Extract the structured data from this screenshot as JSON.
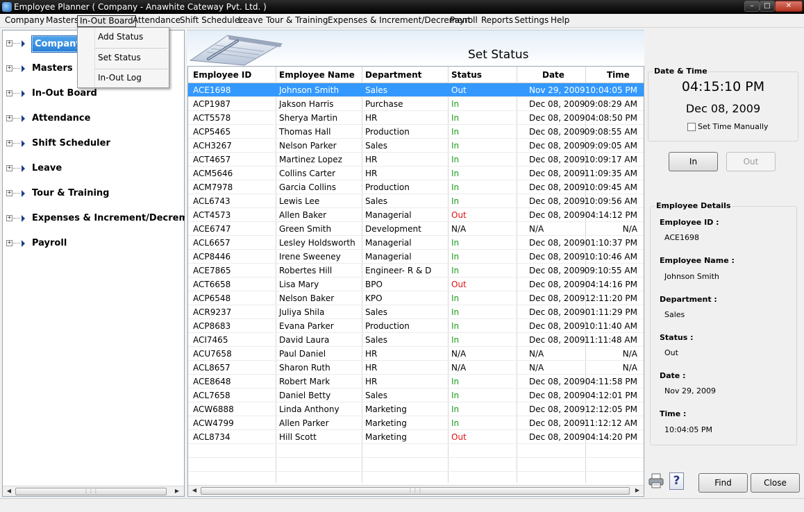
{
  "window": {
    "title": "Employee Planner ( Company - Anawhite Cateway Pvt. Ltd. )"
  },
  "menubar": {
    "items": [
      "Company",
      "Masters",
      "In-Out Board",
      "Attendance",
      "Shift Scheduler",
      "Leave",
      "Tour & Training",
      "Expenses & Increment/Decrement",
      "Payroll",
      "Reports",
      "Settings",
      "Help"
    ],
    "open_item": "In-Out Board"
  },
  "dropdown": {
    "items": [
      "Add Status",
      "Set Status",
      "In-Out Log"
    ]
  },
  "tree": {
    "items": [
      "Company",
      "Masters",
      "In-Out Board",
      "Attendance",
      "Shift Scheduler",
      "Leave",
      "Tour & Training",
      "Expenses & Increment/Decrement",
      "Payroll"
    ],
    "selected": "Company"
  },
  "main": {
    "heading": "Set Status"
  },
  "grid": {
    "columns": [
      "Employee ID",
      "Employee Name",
      "Department",
      "Status",
      "Date",
      "Time"
    ],
    "selected_row": 0,
    "rows": [
      [
        "ACE1698",
        "Johnson Smith",
        "Sales",
        "Out",
        "Nov 29, 2009",
        "10:04:05 PM"
      ],
      [
        "ACP1987",
        "Jakson Harris",
        "Purchase",
        "In",
        "Dec 08, 2009",
        "09:08:29 AM"
      ],
      [
        "ACT5578",
        "Sherya Martin",
        "HR",
        "In",
        "Dec 08, 2009",
        "04:08:50 PM"
      ],
      [
        "ACP5465",
        "Thomas Hall",
        "Production",
        "In",
        "Dec 08, 2009",
        "09:08:55 AM"
      ],
      [
        "ACH3267",
        "Nelson Parker",
        "Sales",
        "In",
        "Dec 08, 2009",
        "09:09:05 AM"
      ],
      [
        "ACT4657",
        "Martinez Lopez",
        "HR",
        "In",
        "Dec 08, 2009",
        "10:09:17 AM"
      ],
      [
        "ACM5646",
        "Collins Carter",
        "HR",
        "In",
        "Dec 08, 2009",
        "11:09:35 AM"
      ],
      [
        "ACM7978",
        "Garcia Collins",
        "Production",
        "In",
        "Dec 08, 2009",
        "10:09:45 AM"
      ],
      [
        "ACL6743",
        "Lewis Lee",
        "Sales",
        "In",
        "Dec 08, 2009",
        "10:09:56 AM"
      ],
      [
        "ACT4573",
        "Allen Baker",
        "Managerial",
        "Out",
        "Dec 08, 2009",
        "04:14:12 PM"
      ],
      [
        "ACE6747",
        "Green Smith",
        "Development",
        "N/A",
        "N/A",
        "N/A"
      ],
      [
        "ACL6657",
        "Lesley Holdsworth",
        "Managerial",
        "In",
        "Dec 08, 2009",
        "01:10:37 PM"
      ],
      [
        "ACP8446",
        "Irene Sweeney",
        "Managerial",
        "In",
        "Dec 08, 2009",
        "10:10:46 AM"
      ],
      [
        "ACE7865",
        "Robertes Hill",
        "Engineer- R & D",
        "In",
        "Dec 08, 2009",
        "09:10:55 AM"
      ],
      [
        "ACT6658",
        "Lisa Mary",
        "BPO",
        "Out",
        "Dec 08, 2009",
        "04:14:16 PM"
      ],
      [
        "ACP6548",
        "Nelson Baker",
        "KPO",
        "In",
        "Dec 08, 2009",
        "12:11:20 PM"
      ],
      [
        "ACR9237",
        "Juliya Shila",
        "Sales",
        "In",
        "Dec 08, 2009",
        "01:11:29 PM"
      ],
      [
        "ACP8683",
        "Evana Parker",
        "Production",
        "In",
        "Dec 08, 2009",
        "10:11:40 AM"
      ],
      [
        "ACI7465",
        "David Laura",
        "Sales",
        "In",
        "Dec 08, 2009",
        "11:11:48 AM"
      ],
      [
        "ACU7658",
        "Paul Daniel",
        "HR",
        "N/A",
        "N/A",
        "N/A"
      ],
      [
        "ACL8657",
        "Sharon Ruth",
        "HR",
        "N/A",
        "N/A",
        "N/A"
      ],
      [
        "ACE8648",
        "Robert Mark",
        "HR",
        "In",
        "Dec 08, 2009",
        "04:11:58 PM"
      ],
      [
        "ACL7658",
        "Daniel Betty",
        "Sales",
        "In",
        "Dec 08, 2009",
        "04:12:01 PM"
      ],
      [
        "ACW6888",
        "Linda Anthony",
        "Marketing",
        "In",
        "Dec 08, 2009",
        "12:12:05 PM"
      ],
      [
        "ACW4799",
        "Allen Parker",
        "Marketing",
        "In",
        "Dec 08, 2009",
        "11:12:12 AM"
      ],
      [
        "ACL8734",
        "Hill Scott",
        "Marketing",
        "Out",
        "Dec 08, 2009",
        "04:14:20 PM"
      ]
    ]
  },
  "datetime": {
    "group_title": "Date & Time",
    "time": "04:15:10 PM",
    "date": "Dec 08, 2009",
    "manual_label": "Set Time Manually",
    "manual_checked": false
  },
  "actions": {
    "in_label": "In",
    "out_label": "Out",
    "out_enabled": false
  },
  "details": {
    "group_title": "Employee Details",
    "fields": [
      {
        "label": "Employee ID :",
        "value": "ACE1698"
      },
      {
        "label": "Employee Name :",
        "value": "Johnson Smith"
      },
      {
        "label": "Department :",
        "value": "Sales"
      },
      {
        "label": "Status :",
        "value": "Out"
      },
      {
        "label": "Date :",
        "value": "Nov 29, 2009"
      },
      {
        "label": "Time :",
        "value": "10:04:05 PM"
      }
    ]
  },
  "footer": {
    "find_label": "Find",
    "close_label": "Close",
    "help_glyph": "?"
  },
  "icons": {
    "print": "printer-icon",
    "help": "help-icon",
    "app": "app-icon"
  },
  "colors": {
    "selection": "#3399ff",
    "status_in": "#1f9a1f",
    "status_out": "#e01010"
  }
}
